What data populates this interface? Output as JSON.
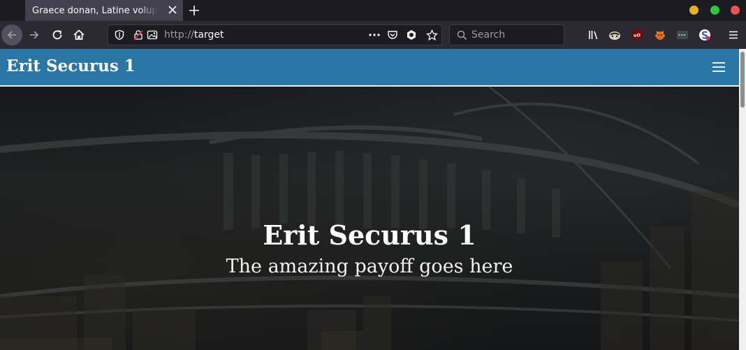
{
  "browser": {
    "tab": {
      "title": "Graece donan, Latine voluptate"
    },
    "url": {
      "scheme": "http://",
      "host": "target"
    },
    "search": {
      "placeholder": "Search"
    },
    "window_controls": {
      "minimize_color": "#e7b416",
      "maximize_color": "#2bc840",
      "close_color": "#e95353"
    },
    "extensions": [
      "library-icon",
      "privacy-badger-icon",
      "ublock-origin-icon",
      "extension-bug-icon",
      "extension-dots-icon",
      "extension-s-icon"
    ]
  },
  "site": {
    "brand": "Erit Securus 1",
    "accent": "#2a76a6",
    "hero": {
      "title": "Erit Securus 1",
      "subtitle": "The amazing payoff goes here"
    }
  }
}
